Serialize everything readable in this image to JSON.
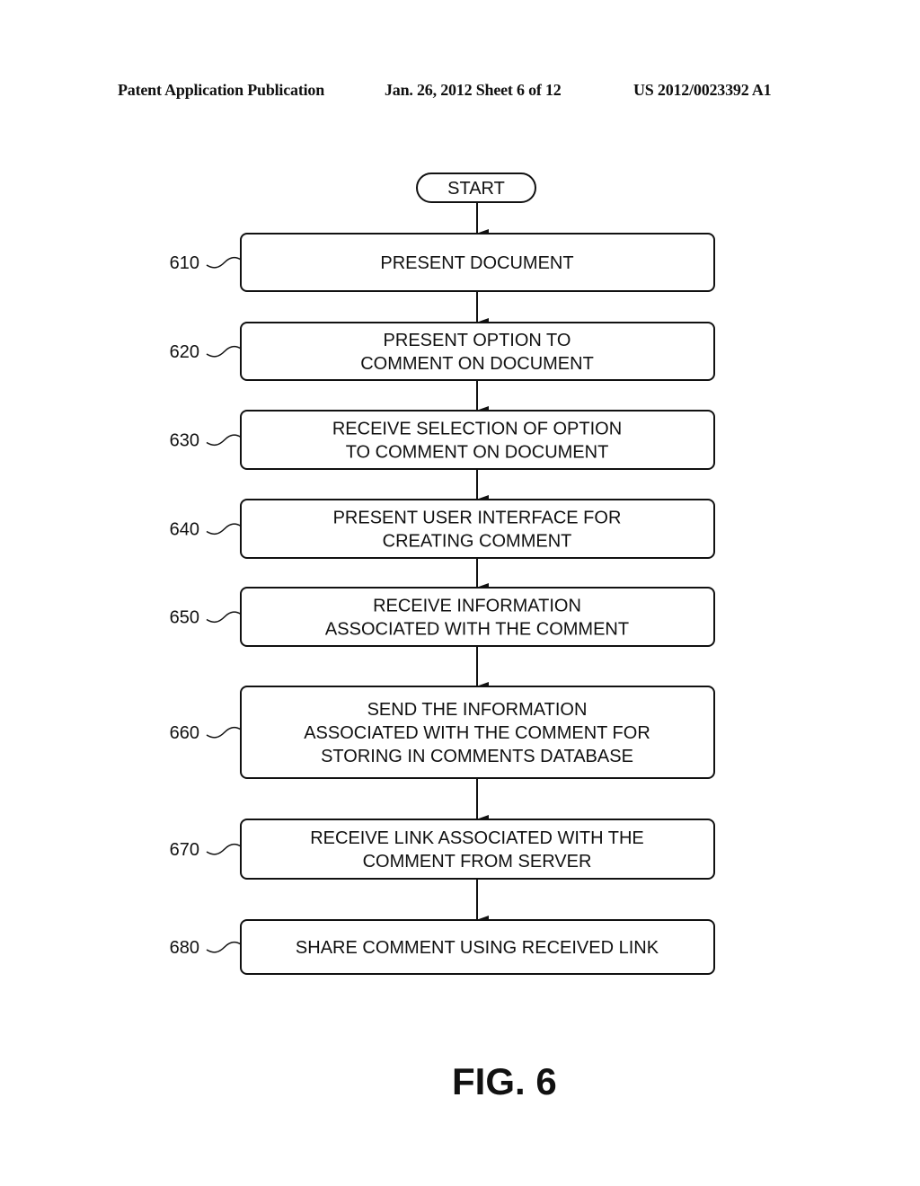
{
  "header": {
    "left": "Patent Application Publication",
    "middle": "Jan. 26, 2012   Sheet 6 of 12",
    "right": "US 2012/0023392 A1"
  },
  "diagram": {
    "start_label": "START",
    "steps": [
      {
        "ref": "610",
        "lines": [
          "PRESENT DOCUMENT"
        ]
      },
      {
        "ref": "620",
        "lines": [
          "PRESENT OPTION TO",
          "COMMENT ON DOCUMENT"
        ]
      },
      {
        "ref": "630",
        "lines": [
          "RECEIVE SELECTION OF OPTION",
          "TO COMMENT ON DOCUMENT"
        ]
      },
      {
        "ref": "640",
        "lines": [
          "PRESENT USER INTERFACE FOR",
          "CREATING COMMENT"
        ]
      },
      {
        "ref": "650",
        "lines": [
          "RECEIVE INFORMATION",
          "ASSOCIATED WITH THE COMMENT"
        ]
      },
      {
        "ref": "660",
        "lines": [
          "SEND THE INFORMATION",
          "ASSOCIATED WITH THE COMMENT FOR",
          "STORING IN COMMENTS DATABASE"
        ]
      },
      {
        "ref": "670",
        "lines": [
          "RECEIVE LINK ASSOCIATED WITH THE",
          "COMMENT FROM SERVER"
        ]
      },
      {
        "ref": "680",
        "lines": [
          "SHARE COMMENT USING RECEIVED LINK"
        ]
      }
    ]
  },
  "figure_label": "FIG. 6"
}
